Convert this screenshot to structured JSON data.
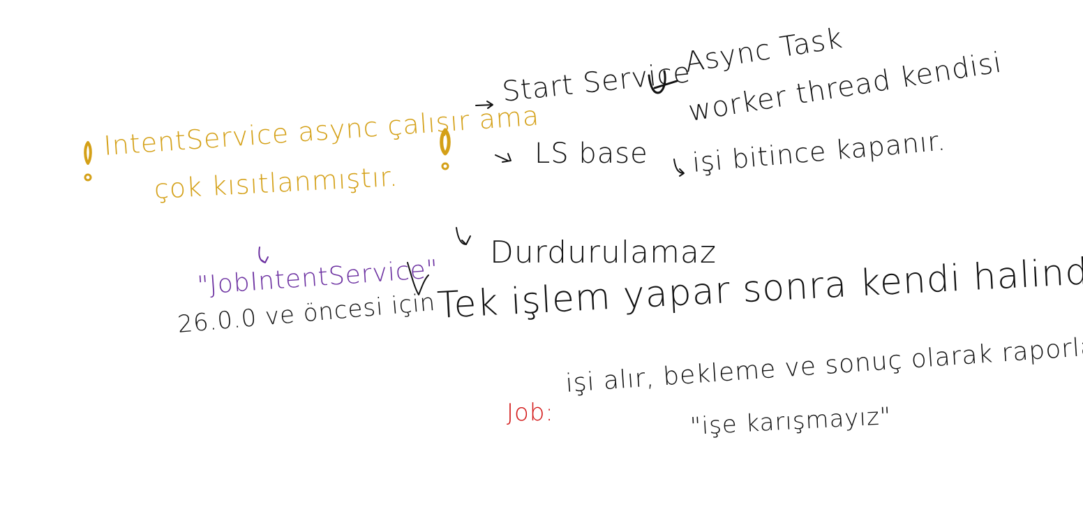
{
  "notes": {
    "start_service": "Start Service",
    "async_task": "Async Task",
    "worker_thread": "worker thread kendisi",
    "is_bitince": "işi bitince kapanır.",
    "ls_base": "LS base",
    "intent_service_line1": "IntentService async çalışır ama",
    "intent_service_line2": "çok kısıtlanmıştır.",
    "durdurulamaz": "Durdurulamaz",
    "job_intent_service": "\"JobIntentService\"",
    "version_note": "26.0.0 ve öncesi için",
    "tek_islem": "Tek işlem yapar sonra kendi halinde",
    "job_label": "Job:",
    "job_desc": "işi alır, bekleme ve sonuç olarak raporlama",
    "ise_karismayiz": "\"işe karışmayız\""
  },
  "colors": {
    "ink": "#111111",
    "highlight": "#d4a017",
    "accent_purple": "#6b2fa0",
    "accent_red": "#d21414"
  }
}
